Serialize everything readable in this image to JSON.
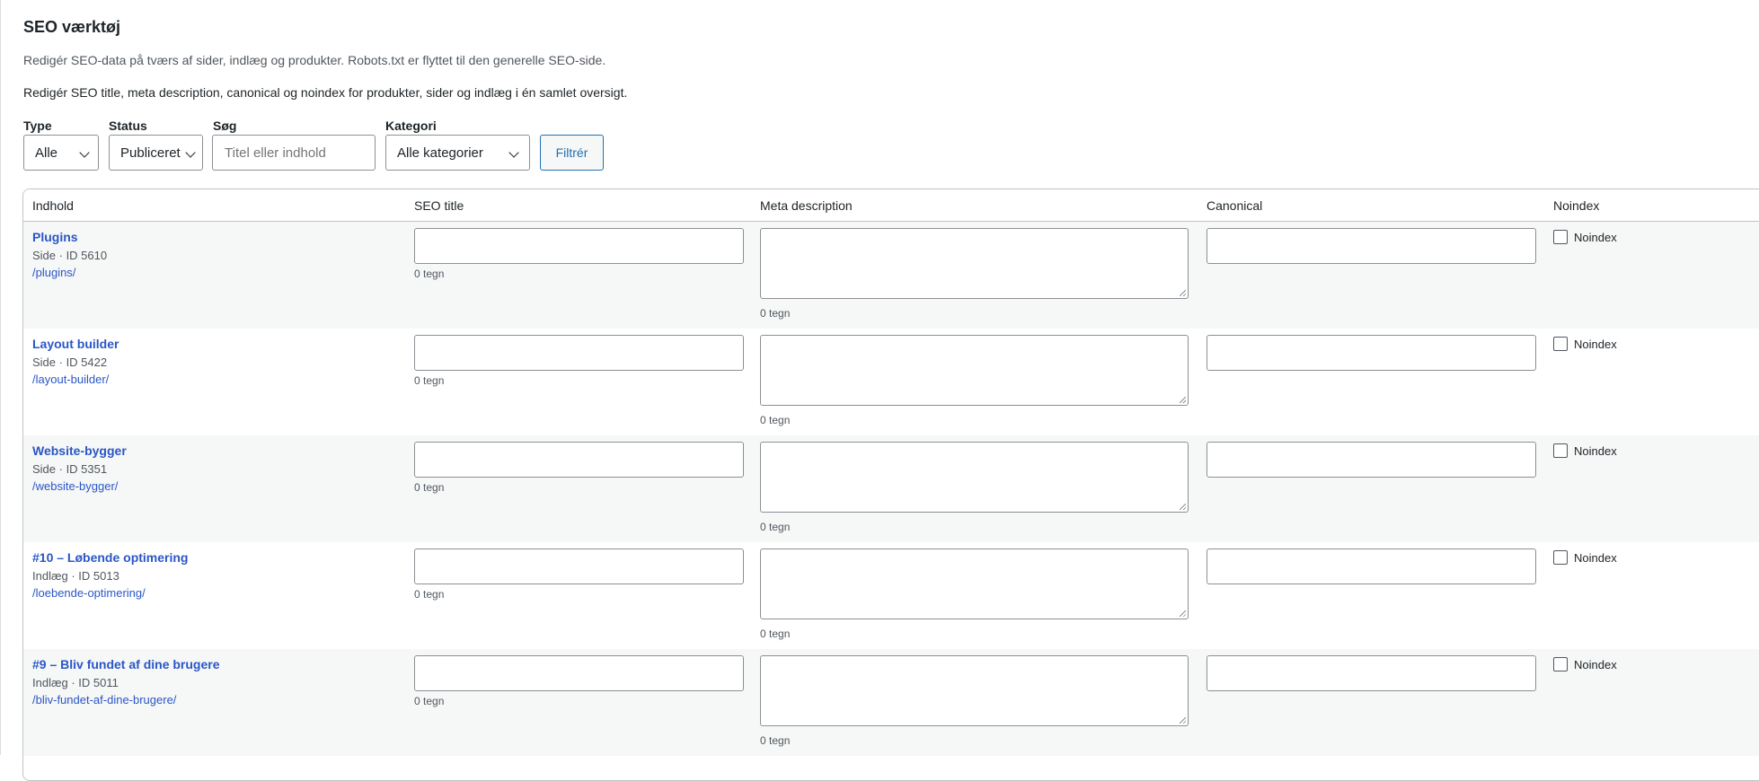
{
  "page": {
    "title": "SEO værktøj",
    "subtitle": "Redigér SEO-data på tværs af sider, indlæg og produkter. Robots.txt er flyttet til den generelle SEO-side.",
    "intro": "Redigér SEO title, meta description, canonical og noindex for produkter, sider og indlæg i én samlet oversigt."
  },
  "filters": {
    "type_label": "Type",
    "type_value": "Alle",
    "status_label": "Status",
    "status_value": "Publiceret",
    "search_label": "Søg",
    "search_placeholder": "Titel eller indhold",
    "search_value": "",
    "category_label": "Kategori",
    "category_value": "Alle kategorier",
    "filter_button": "Filtrér"
  },
  "table": {
    "headers": {
      "content": "Indhold",
      "seo_title": "SEO title",
      "meta_description": "Meta description",
      "canonical": "Canonical",
      "noindex": "Noindex"
    },
    "rows": [
      {
        "title": "Plugins",
        "meta": "Side · ID 5610",
        "slug": "/plugins/",
        "seo_title": "",
        "seo_count": "0 tegn",
        "meta_description": "",
        "meta_count": "0 tegn",
        "canonical": "",
        "noindex_label": "Noindex",
        "noindex_checked": false
      },
      {
        "title": "Layout builder",
        "meta": "Side · ID 5422",
        "slug": "/layout-builder/",
        "seo_title": "",
        "seo_count": "0 tegn",
        "meta_description": "",
        "meta_count": "0 tegn",
        "canonical": "",
        "noindex_label": "Noindex",
        "noindex_checked": false
      },
      {
        "title": "Website-bygger",
        "meta": "Side · ID 5351",
        "slug": "/website-bygger/",
        "seo_title": "",
        "seo_count": "0 tegn",
        "meta_description": "",
        "meta_count": "0 tegn",
        "canonical": "",
        "noindex_label": "Noindex",
        "noindex_checked": false
      },
      {
        "title": "#10 – Løbende optimering",
        "meta": "Indlæg · ID 5013",
        "slug": "/loebende-optimering/",
        "seo_title": "",
        "seo_count": "0 tegn",
        "meta_description": "",
        "meta_count": "0 tegn",
        "canonical": "",
        "noindex_label": "Noindex",
        "noindex_checked": false
      },
      {
        "title": "#9 – Bliv fundet af dine brugere",
        "meta": "Indlæg · ID 5011",
        "slug": "/bliv-fundet-af-dine-brugere/",
        "seo_title": "",
        "seo_count": "0 tegn",
        "meta_description": "",
        "meta_count": "0 tegn",
        "canonical": "",
        "noindex_label": "Noindex",
        "noindex_checked": false
      }
    ]
  }
}
